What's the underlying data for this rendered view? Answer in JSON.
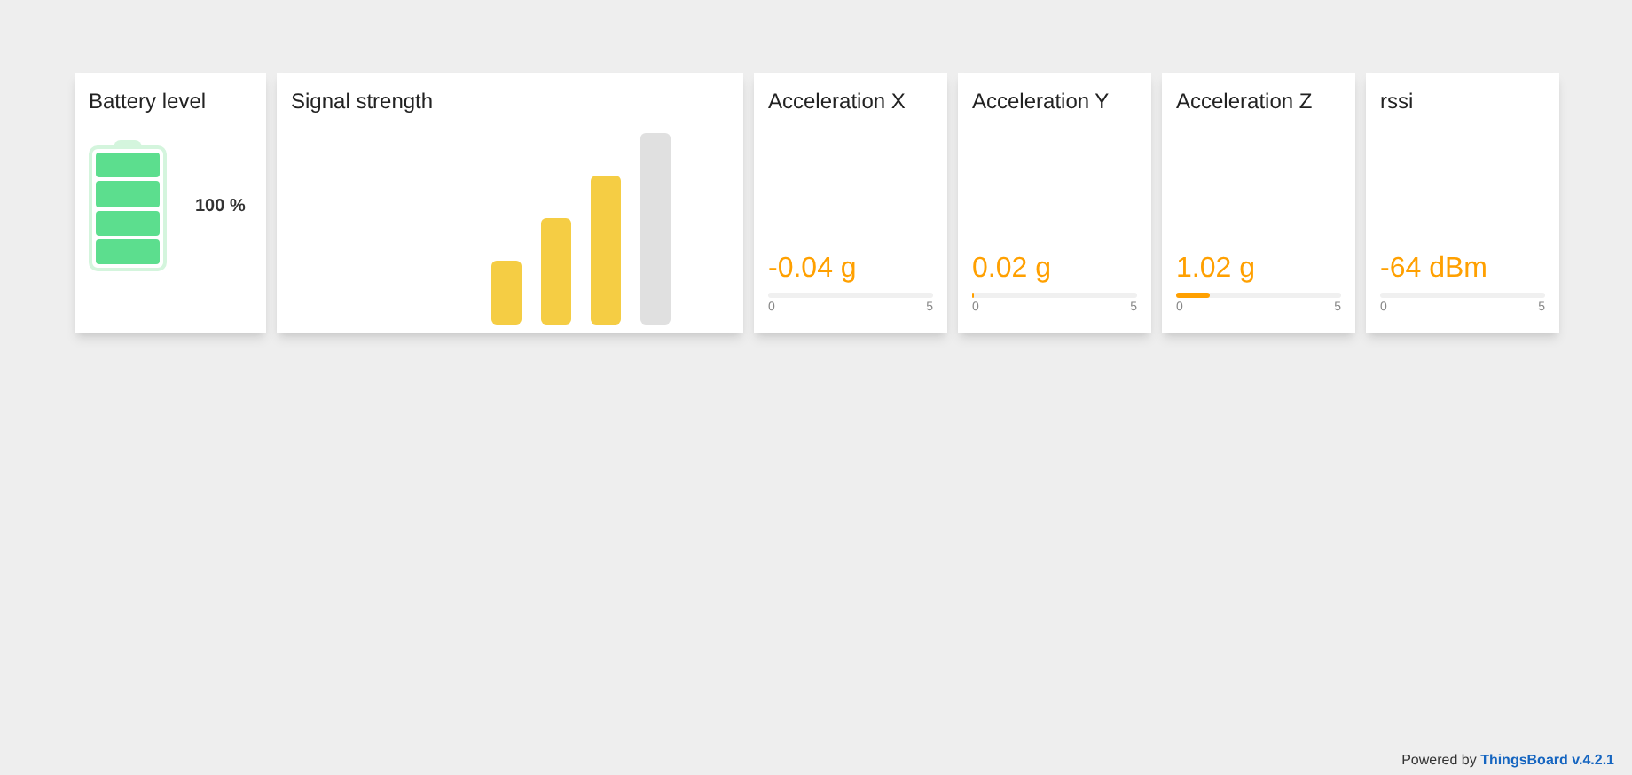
{
  "battery": {
    "title": "Battery level",
    "segments": [
      {
        "filled": true
      },
      {
        "filled": true
      },
      {
        "filled": true
      },
      {
        "filled": true
      }
    ],
    "reading": "100 %"
  },
  "signal": {
    "title": "Signal strength",
    "level": 0.75
  },
  "gauges": [
    {
      "title": "Acceleration X",
      "value": "-0.04 g",
      "min": "0",
      "max": "5"
    },
    {
      "title": "Acceleration Y",
      "value": "0.02 g",
      "level": 0.004,
      "min": "0",
      "max": "5"
    },
    {
      "title": "Acceleration Z",
      "value": "1.02 g",
      "level": 0.204,
      "min": "0",
      "max": "5"
    },
    {
      "title": "rssi",
      "value": "-64 dBm",
      "min": "0",
      "max": "5"
    }
  ],
  "footer": {
    "text": "Powered by",
    "link": "ThingsBoard v.4.2.1"
  }
}
